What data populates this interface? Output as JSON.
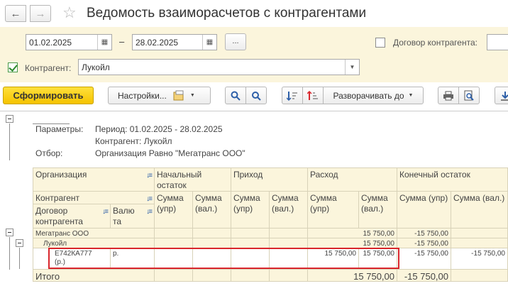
{
  "window": {
    "title": "Ведомость взаиморасчетов с контрагентами"
  },
  "nav": {
    "back_icon": "arrow-left-icon",
    "forward_icon": "arrow-right-icon",
    "favorite_icon": "star-icon"
  },
  "filters": {
    "date_from": "01.02.2025",
    "date_to": "28.02.2025",
    "period_separator": "–",
    "period_button_label": "...",
    "contract_label": "Договор контрагента:",
    "contract_checked": false,
    "counterparty_checked": true,
    "counterparty_label": "Контрагент:",
    "counterparty_value": "Лукойл"
  },
  "toolbar": {
    "generate_label": "Сформировать",
    "settings_label": "Настройки...",
    "expand_label": "Разворачивать до"
  },
  "report": {
    "params_label": "Параметры:",
    "period_text": "Период: 01.02.2025 - 28.02.2025",
    "counterparty_text": "Контрагент: Лукойл",
    "selection_label": "Отбор:",
    "selection_text": "Организация Равно \"Мегатранс ООО\"",
    "headers": {
      "organization": "Организация",
      "counterparty": "Контрагент",
      "contract": "Договор контрагента",
      "currency": "Валюта",
      "opening": "Начальный остаток",
      "income": "Приход",
      "expense": "Расход",
      "closing": "Конечный остаток",
      "sum_upr": "Сумма (упр)",
      "sum_val": "Сумма (вал.)"
    },
    "rows": {
      "org_name": "Мегатранс ООО",
      "org_expense_upr": "15 750,00",
      "org_closing_upr": "-15 750,00",
      "cp_name": "Лукойл",
      "cp_expense_upr": "15 750,00",
      "cp_closing_upr": "-15 750,00",
      "contract_name": "Е742КА777 (р.)",
      "contract_currency": "р.",
      "contract_expense_upr": "15 750,00",
      "contract_expense_val": "15 750,00",
      "contract_closing_upr": "-15 750,00",
      "contract_closing_val": "-15 750,00",
      "total_label": "Итого",
      "total_expense_upr": "15 750,00",
      "total_closing_upr": "-15 750,00"
    }
  },
  "colors": {
    "accent_yellow": "#f5c300",
    "panel_bg": "#fbf5dc",
    "highlight_red": "#d9262c"
  }
}
